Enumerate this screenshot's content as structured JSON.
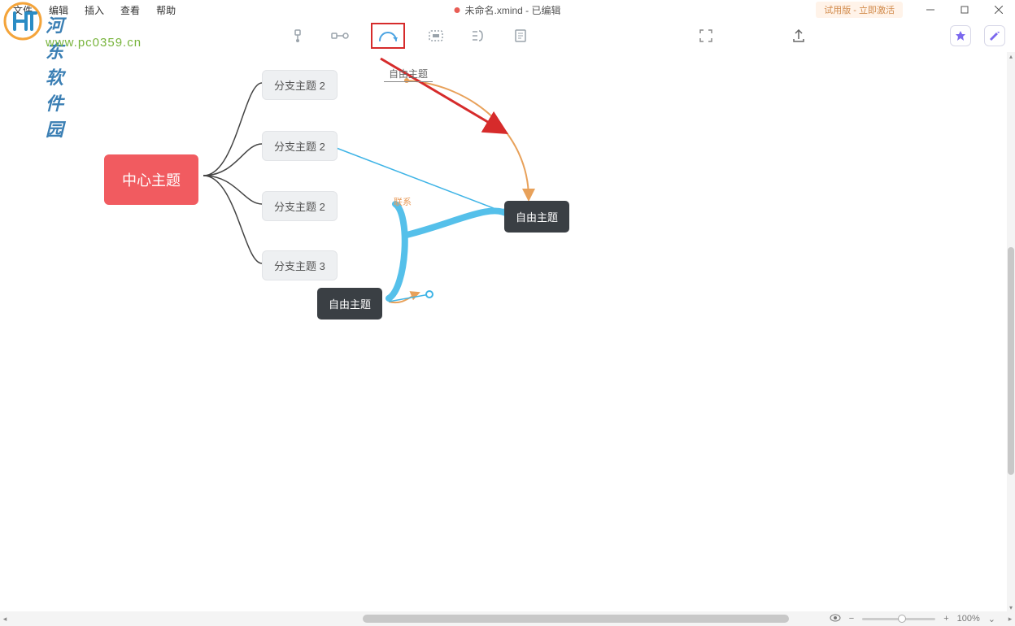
{
  "menubar": {
    "items": [
      "文件",
      "编辑",
      "插入",
      "查看",
      "帮助"
    ],
    "title": "未命名.xmind - 已编辑",
    "trial_badge": "试用版 - 立即激活"
  },
  "watermark": {
    "line1": "河东软件园",
    "line2": "www.pc0359.cn"
  },
  "toolbar": {
    "icons": [
      "subtopic",
      "link-topic",
      "relationship",
      "boundary",
      "summary",
      "note"
    ],
    "right_icons": [
      "fullscreen",
      "share",
      "star",
      "theme"
    ]
  },
  "mindmap": {
    "central": "中心主题",
    "branches": [
      "分支主题 2",
      "分支主题 2",
      "分支主题 2",
      "分支主题 3"
    ],
    "floating_label": "自由主题",
    "free_topics": [
      "自由主题",
      "自由主题"
    ],
    "relationship_label": "联系"
  },
  "statusbar": {
    "zoom": "100%"
  }
}
